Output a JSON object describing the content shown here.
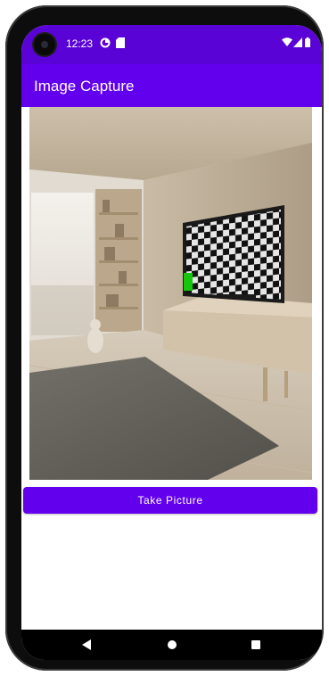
{
  "status_bar": {
    "time": "12:23",
    "icons": [
      "camera-punch-hole-icon",
      "notification-app-icon",
      "sd-card-icon",
      "wifi-icon",
      "cellular-signal-icon",
      "battery-icon"
    ]
  },
  "app_bar": {
    "title": "Image Capture"
  },
  "preview": {
    "image_description_icon": "captured-room-photo"
  },
  "actions": {
    "take_picture_label": "Take Picture"
  },
  "navigation": {
    "icons": [
      "back-icon",
      "home-icon",
      "recents-icon"
    ]
  },
  "colors": {
    "primary": "#6200ee",
    "primary_dark": "#5a03d6",
    "on_primary": "#ffffff",
    "nav_bar": "#000000"
  }
}
